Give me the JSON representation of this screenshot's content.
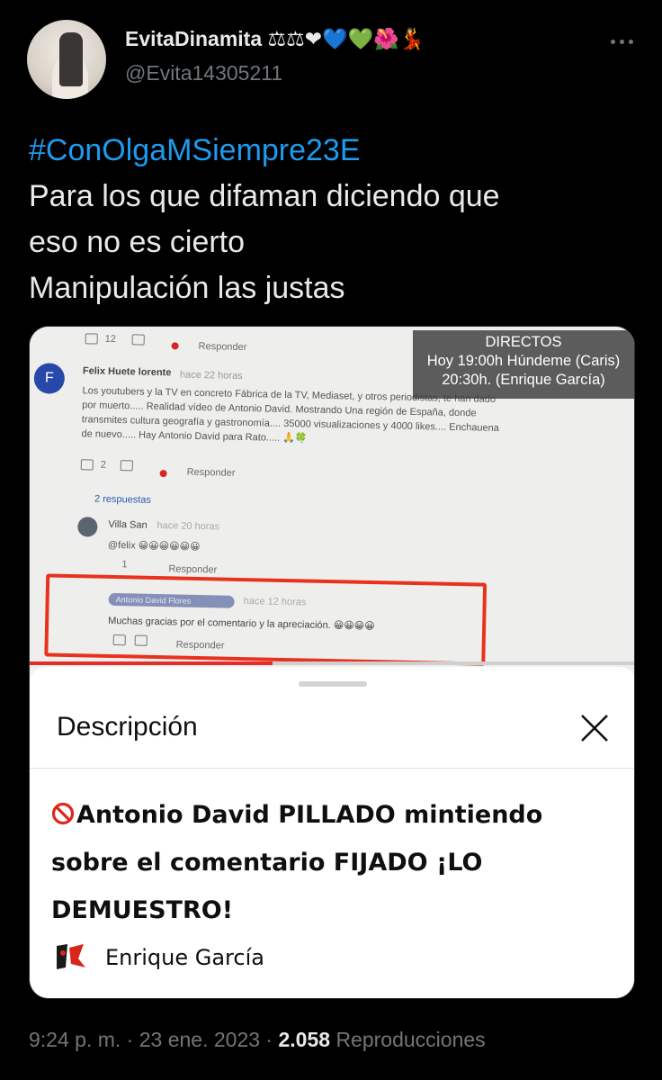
{
  "author": {
    "display_name": "EvitaDinamita",
    "name_emojis": "⚖⚖❤💙💚🌺💃",
    "handle": "@Evita14305211"
  },
  "tweet": {
    "hashtag": "#ConOlgaMSiempre23E",
    "lines": [
      "Para los que difaman diciendo que",
      "eso no es cierto",
      "Manipulación las justas"
    ]
  },
  "media": {
    "overlay": {
      "line1": "DIRECTOS",
      "line2": "Hoy 19:00h Húndeme (Caris)",
      "line3": "20:30h. (Enrique García)"
    },
    "screen": {
      "top_count": "12",
      "reply_label": "Responder",
      "comment1_avatar_letter": "F",
      "comment1_author": "Felix Huete lorente",
      "comment1_time": "hace 22 horas",
      "comment1_text": "Los youtubers y la TV en concreto Fábrica de la TV, Mediaset, y otros periodistas, te han dado por muerto..... Realidad vídeo de Antonio David. Mostrando Una región de España, donde transmites cultura geografía y gastronomía.... 35000 visualizaciones y 4000 likes.... Enchauena de nuevo..... Hay Antonio David para Rato..... 🙏🍀",
      "comment1_likes": "2",
      "replies_label": "2 respuestas",
      "comment2_author": "Villa San",
      "comment2_time": "hace 20 horas",
      "comment2_text": "@felix 😀😀😀😀😀😀",
      "comment2_likes": "1",
      "comment3_author": "Antonio David Flores",
      "comment3_time": "hace 12 horas",
      "comment3_text": "Muchas gracias por el comentario y la apreciación. 😀😀😀😀",
      "progress_fraction": 0.4
    },
    "sheet": {
      "title": "Descripción",
      "video_title": "Antonio David PILLADO mintiendo sobre el comentario FIJADO ¡LO DEMUESTRO!",
      "channel_name": "Enrique García"
    }
  },
  "footer": {
    "time": "9:24 p. m.",
    "date": "23 ene. 2023",
    "views": "2.058",
    "views_label": "Reproducciones"
  }
}
